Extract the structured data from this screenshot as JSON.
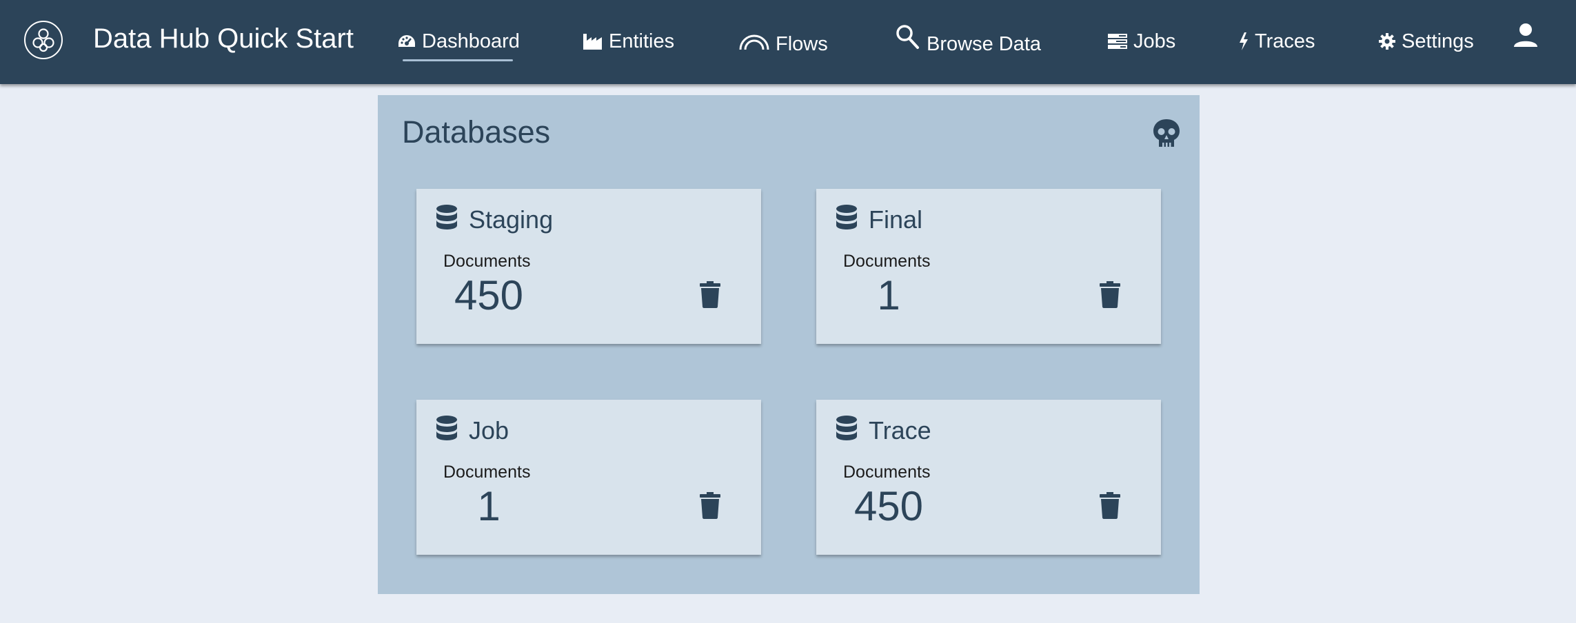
{
  "header": {
    "app_title": "Data Hub Quick Start",
    "logo_icon": "data-hub-logo-icon",
    "nav": [
      {
        "label": "Dashboard",
        "icon": "dashboard-icon",
        "active": true
      },
      {
        "label": "Entities",
        "icon": "factory-icon"
      },
      {
        "label": "Flows",
        "icon": "rainbow-icon"
      },
      {
        "label": "Browse Data",
        "icon": "search-icon"
      },
      {
        "label": "Jobs",
        "icon": "tasks-icon"
      },
      {
        "label": "Traces",
        "icon": "bolt-icon"
      },
      {
        "label": "Settings",
        "icon": "gear-icon"
      }
    ],
    "user_icon": "user-icon",
    "background_color": "#2c4459",
    "text_color": "#ffffff"
  },
  "panel": {
    "title": "Databases",
    "reset_icon": "skull-icon",
    "background_color": "#afc5d7",
    "databases": [
      {
        "name": "Staging",
        "documents_label": "Documents",
        "count": "450",
        "icon": "database-icon",
        "delete_icon": "trash-icon"
      },
      {
        "name": "Final",
        "documents_label": "Documents",
        "count": "1",
        "icon": "database-icon",
        "delete_icon": "trash-icon"
      },
      {
        "name": "Job",
        "documents_label": "Documents",
        "count": "1",
        "icon": "database-icon",
        "delete_icon": "trash-icon"
      },
      {
        "name": "Trace",
        "documents_label": "Documents",
        "count": "450",
        "icon": "database-icon",
        "delete_icon": "trash-icon"
      }
    ]
  },
  "colors": {
    "page_background": "#e8edf5",
    "card_background": "#d8e3ec",
    "accent": "#2c4459"
  }
}
